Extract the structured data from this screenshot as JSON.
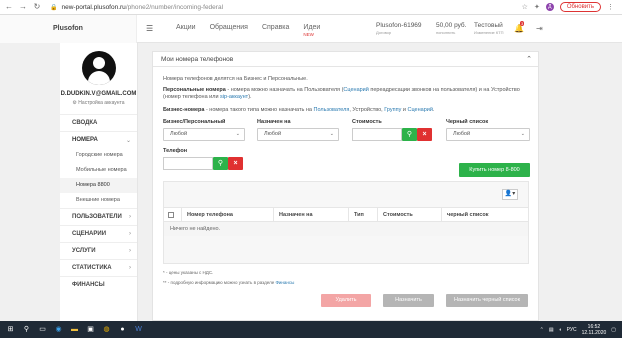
{
  "browser": {
    "url_host": "new-portal.plusofon.ru",
    "url_path": "/phone2/number/incoming-federal",
    "profile_initial": "Д",
    "update_label": "Обновить"
  },
  "header": {
    "brand": "Plusofon",
    "nav": [
      {
        "label": "Акции"
      },
      {
        "label": "Обращения"
      },
      {
        "label": "Справка"
      },
      {
        "label": "Идеи",
        "badge": "NEW"
      }
    ],
    "account_id": "Plusofon-61969",
    "account_sub": "Договор",
    "balance": "50,00 руб.",
    "balance_sub": "пополнить",
    "tariff": "Тестовый",
    "tariff_sub": "Изменение КТП",
    "bell_badge": "3"
  },
  "sidebar": {
    "user_email": "D.DUDKIN.V@GMAIL.COM",
    "settings_label": "Настройка аккаунта",
    "items": [
      {
        "label": "СВОДКА"
      },
      {
        "label": "НОМЕРА",
        "expanded": true
      },
      {
        "label": "ПОЛЬЗОВАТЕЛИ"
      },
      {
        "label": "СЦЕНАРИИ"
      },
      {
        "label": "УСЛУГИ"
      },
      {
        "label": "СТАТИСТИКА"
      },
      {
        "label": "ФИНАНСЫ"
      }
    ],
    "sub_items": [
      {
        "label": "Городские номера"
      },
      {
        "label": "Мобильные номера"
      },
      {
        "label": "Номера 8800",
        "active": true
      },
      {
        "label": "Внешние номера"
      }
    ]
  },
  "panel": {
    "title": "Мои номера телефонов",
    "info1": "Номера телефонов делятся на Бизнес и Персональные.",
    "info2_b": "Персональные номера",
    "info2_rest": " - номера можно назначать на Пользователя (",
    "info2_link1": "Сценарий",
    "info2_rest2": " переадресации звонков на пользователя) и на Устройство (номер телефона или ",
    "info2_link2": "sip-аккаунт",
    "info2_rest3": ").",
    "info3_b": "Бизнес-номера",
    "info3_rest": " - номера такого типа можно назначать на ",
    "info3_link1": "Пользователя",
    "info3_rest2": ", Устройство, ",
    "info3_link2": "Группу",
    "info3_rest3": " и ",
    "info3_link3": "Сценарий",
    "info3_rest4": ".",
    "filters": {
      "type_label": "Бизнес/Персональный",
      "type_value": "Любой",
      "assigned_label": "Назначен на",
      "assigned_value": "Любой",
      "cost_label": "Стоимость",
      "blacklist_label": "Черный список",
      "blacklist_value": "Любой",
      "phone_label": "Телефон"
    },
    "buy_button": "Купить номер 8-800",
    "table": {
      "columns": [
        "Номер телефона",
        "Назначен на",
        "Тип",
        "Стоимость",
        "черный список"
      ],
      "empty": "Ничего не найдено."
    },
    "note1": "* - цены указаны с НДС.",
    "note2_a": "** - подробную информацию можно узнать в разделе ",
    "note2_link": "Финансы",
    "actions": {
      "delete": "Удалить",
      "assign": "Назначить",
      "assign_blacklist": "Назначить черный список"
    }
  },
  "taskbar": {
    "lang": "РУС",
    "time": "16:52",
    "date": "12.11.2020"
  },
  "colors": {
    "green": "#2db24a",
    "red": "#e03131",
    "disabled_red": "#f3a5a5",
    "disabled_gray": "#b5b5b5",
    "link": "#2a7ab0"
  }
}
